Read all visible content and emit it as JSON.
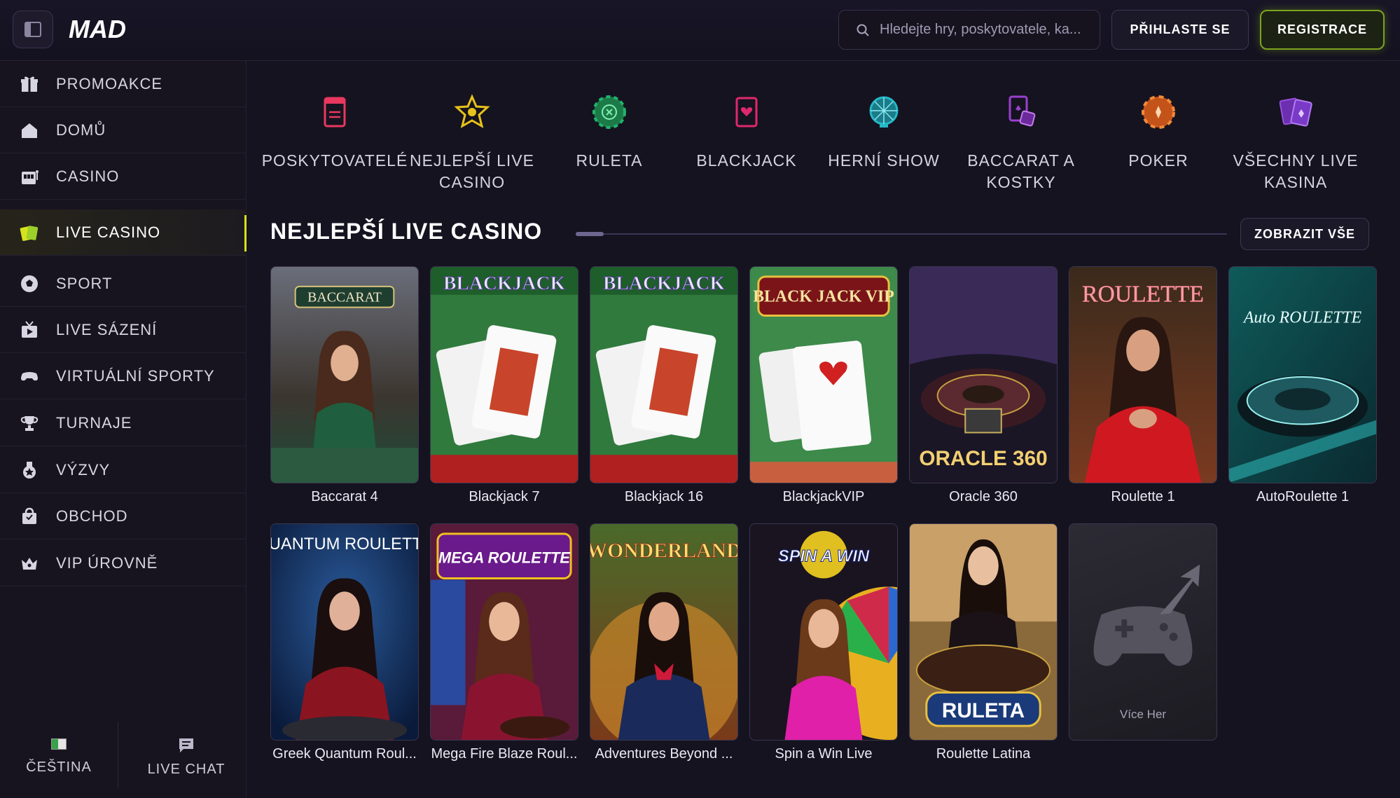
{
  "header": {
    "logo_text": "MAD",
    "search_placeholder": "Hledejte hry, poskytovatele, ka...",
    "login_label": "PŘIHLASTE SE",
    "register_label": "REGISTRACE",
    "accent_color": "#8fbf1c"
  },
  "sidebar": {
    "items": [
      {
        "label": "PROMOAKCE",
        "icon": "gift-icon"
      },
      {
        "label": "DOMŮ",
        "icon": "home-icon"
      },
      {
        "label": "CASINO",
        "icon": "slot-machine-icon"
      },
      {
        "label": "LIVE CASINO",
        "icon": "cards-icon",
        "active": true
      },
      {
        "label": "SPORT",
        "icon": "soccer-ball-icon"
      },
      {
        "label": "LIVE SÁZENÍ",
        "icon": "tv-icon"
      },
      {
        "label": "VIRTUÁLNÍ SPORTY",
        "icon": "gamepad-icon"
      },
      {
        "label": "TURNAJE",
        "icon": "trophy-icon"
      },
      {
        "label": "VÝZVY",
        "icon": "medal-icon"
      },
      {
        "label": "OBCHOD",
        "icon": "shopping-bag-icon"
      },
      {
        "label": "VIP ÚROVNĚ",
        "icon": "crown-icon"
      }
    ],
    "footer": {
      "language_label": "ČEŠTINA",
      "chat_label": "LIVE CHAT"
    }
  },
  "categories": [
    {
      "label": "POSKYTOVATELÉ",
      "icon": "book-icon",
      "color": "#e8385f"
    },
    {
      "label": "NEJLEPŠÍ LIVE CASINO",
      "icon": "star-badge-icon",
      "color": "#e8c21a"
    },
    {
      "label": "RULETA",
      "icon": "roulette-chip-icon",
      "color": "#20b46a"
    },
    {
      "label": "BLACKJACK",
      "icon": "card-heart-icon",
      "color": "#e0286e"
    },
    {
      "label": "HERNÍ SHOW",
      "icon": "wheel-icon",
      "color": "#24b8c8"
    },
    {
      "label": "BACCARAT A KOSTKY",
      "icon": "cards-dice-icon",
      "color": "#9a3fd0"
    },
    {
      "label": "POKER",
      "icon": "poker-chip-icon",
      "color": "#e86a1c"
    },
    {
      "label": "VŠECHNY LIVE KASINA",
      "icon": "all-cards-icon",
      "color": "#9a4fe0"
    }
  ],
  "section": {
    "title": "NEJLEPŠÍ LIVE CASINO",
    "view_all_label": "ZOBRAZIT VŠE"
  },
  "games": [
    {
      "title": "Baccarat 4",
      "art_text": "BACCARAT"
    },
    {
      "title": "Blackjack 7",
      "art_text": "BLACKJACK"
    },
    {
      "title": "Blackjack 16",
      "art_text": "BLACKJACK"
    },
    {
      "title": "BlackjackVIP",
      "art_text": "BLACK JACK VIP"
    },
    {
      "title": "Oracle 360",
      "art_text": "ORACLE 360"
    },
    {
      "title": "Roulette 1",
      "art_text": "ROULETTE"
    },
    {
      "title": "AutoRoulette 1",
      "art_text": "Auto ROULETTE"
    },
    {
      "title": "Greek Quantum Roul...",
      "art_text": "QUANTUM ROULETTE"
    },
    {
      "title": "Mega Fire Blaze Roul...",
      "art_text": "MEGA ROULETTE"
    },
    {
      "title": "Adventures Beyond ...",
      "art_text": "WONDERLAND"
    },
    {
      "title": "Spin a Win Live",
      "art_text": "SPIN A WIN"
    },
    {
      "title": "Roulette Latina",
      "art_text": "RULETA"
    }
  ],
  "more_games_label": "Více Her"
}
